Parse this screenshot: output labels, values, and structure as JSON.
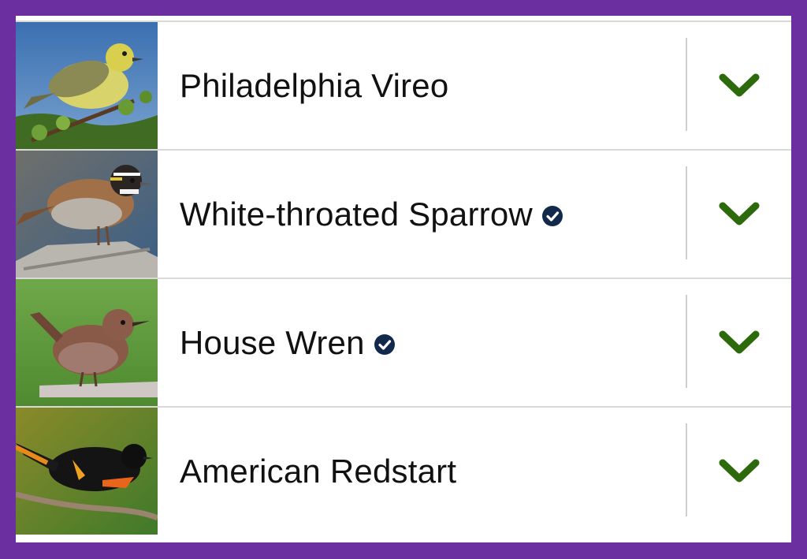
{
  "colors": {
    "frame": "#6b2fa0",
    "chevron": "#2d6a0c",
    "badge": "#13294b",
    "divider": "#cfcfcf"
  },
  "birds": [
    {
      "name": "Philadelphia Vireo",
      "verified": false,
      "expand_icon": "chevron-down-icon"
    },
    {
      "name": "White-throated Sparrow",
      "verified": true,
      "expand_icon": "chevron-down-icon"
    },
    {
      "name": "House Wren",
      "verified": true,
      "expand_icon": "chevron-down-icon"
    },
    {
      "name": "American Redstart",
      "verified": false,
      "expand_icon": "chevron-down-icon"
    }
  ]
}
